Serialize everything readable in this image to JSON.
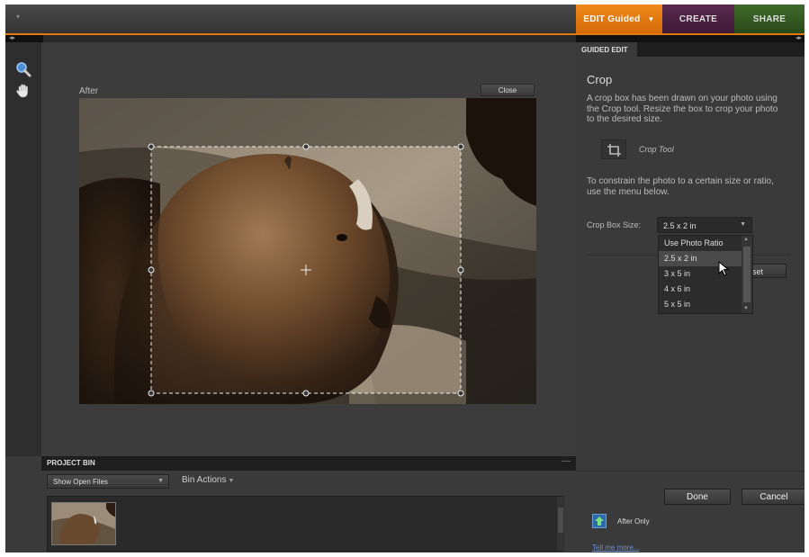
{
  "workspace_tabs": {
    "edit": "EDIT Guided",
    "create": "CREATE",
    "share": "SHARE"
  },
  "canvas": {
    "view_label": "After",
    "close_label": "Close"
  },
  "project_bin": {
    "title": "PROJECT BIN",
    "show_select": "Show Open Files",
    "actions_label": "Bin Actions"
  },
  "guided_panel": {
    "tab_label": "GUIDED EDIT",
    "title": "Crop",
    "description": "A crop box has been drawn on your photo using the Crop tool. Resize the box to crop your photo to the desired size.",
    "tool_label": "Crop Tool",
    "constrain_text": "To constrain the photo to a certain size or ratio, use the menu below.",
    "size_label": "Crop Box Size:",
    "size_value": "2.5 x 2 in",
    "size_options": [
      "Use Photo Ratio",
      "2.5 x 2 in",
      "3 x 5 in",
      "4 x 6 in",
      "5 x 5 in"
    ],
    "selected_option_index": 1,
    "reset_label": "eset",
    "done_label": "Done",
    "cancel_label": "Cancel",
    "view_mode_label": "After Only",
    "tell_more_label": "Tell me more..."
  },
  "colors": {
    "edit_tab": "#e07a10",
    "create_tab": "#4e2444",
    "share_tab": "#356024",
    "link": "#6a8fd0"
  }
}
